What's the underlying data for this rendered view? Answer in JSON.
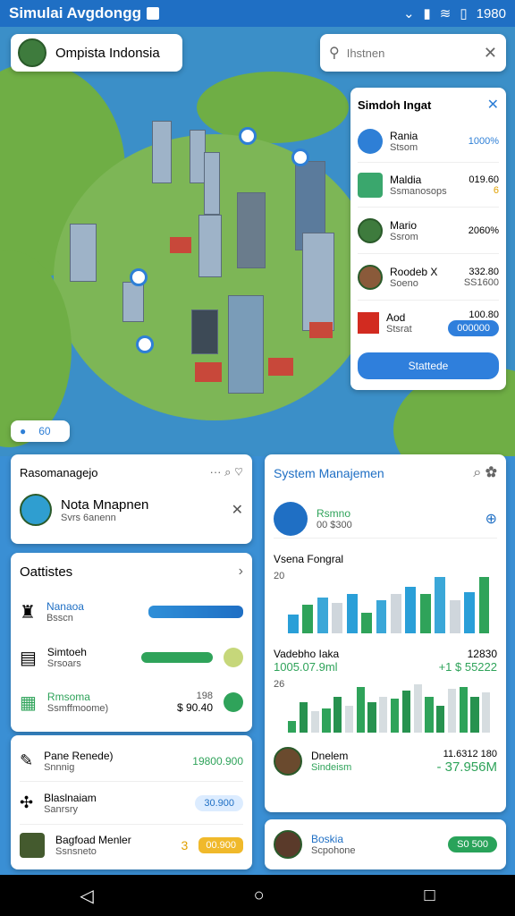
{
  "status": {
    "app_title": "Simulai Avgdongg",
    "time": "1980"
  },
  "map_header": {
    "title": "Ompista Indonsia",
    "search_placeholder": "Ihstnen"
  },
  "side_panel": {
    "title": "Simdoh Ingat",
    "items": [
      {
        "name": "Rania",
        "sub": "Stsom",
        "value": "1000%"
      },
      {
        "name": "Maldia",
        "sub": "Ssmanosops",
        "value": "019.60",
        "extra": "6"
      },
      {
        "name": "Mario",
        "sub": "Ssrom",
        "value": "2060%"
      },
      {
        "name": "Roodeb X",
        "sub": "Soeno",
        "value": "332.80",
        "extra": "SS1600"
      },
      {
        "name": "Aod",
        "sub": "Stsrat",
        "value": "100.80",
        "extra": "000000"
      }
    ],
    "button": "Stattede"
  },
  "map_toggle": "60",
  "left_card": {
    "title": "Rasomanagejo",
    "nota_title": "Nota Mnapnen",
    "nota_sub": "Svrs 6anenn"
  },
  "stats": {
    "title": "Oattistes",
    "rows": [
      {
        "name": "Nanaoa",
        "sub": "Bsscn",
        "value": "18"
      },
      {
        "name": "Simtoeh",
        "sub": "Srsoars"
      },
      {
        "name": "Rmsoma",
        "sub": "Ssmffmoome)",
        "value": "$ 90.40",
        "extra": "198"
      }
    ],
    "list": [
      {
        "name": "Pane Renede)",
        "sub": "Snnnig",
        "value": "19800.900"
      },
      {
        "name": "Blaslnaiam",
        "sub": "Sanrsry",
        "value": "30.900"
      },
      {
        "name": "Bagfoad Menler",
        "sub": "Ssnsneto",
        "value": "3",
        "extra": "00.900"
      }
    ]
  },
  "system": {
    "title": "System Manajemen",
    "top": {
      "name": "Rsmno",
      "sub": "00 $300"
    },
    "chart1": {
      "title": "Vsena Fongral",
      "axis": "20",
      "values": [
        18,
        28,
        35,
        30,
        38,
        20,
        32,
        38,
        45,
        38,
        55,
        32,
        40,
        55
      ]
    },
    "chart2": {
      "title": "Vadebho Iaka",
      "amount": "1005.07.9ml",
      "right_label": "12830",
      "right_value": "+1 $ 55222",
      "axis": "26",
      "values": [
        10,
        25,
        18,
        20,
        30,
        22,
        38,
        25,
        30,
        28,
        35,
        40,
        30,
        22,
        36,
        38,
        30,
        33
      ]
    },
    "user1": {
      "name": "Dnelem",
      "sub": "Sindeism",
      "value": "11.6312 180",
      "amount": "- 37.956M"
    },
    "user2": {
      "name": "Boskia",
      "sub": "Scpohone",
      "value": "S0 500"
    }
  }
}
